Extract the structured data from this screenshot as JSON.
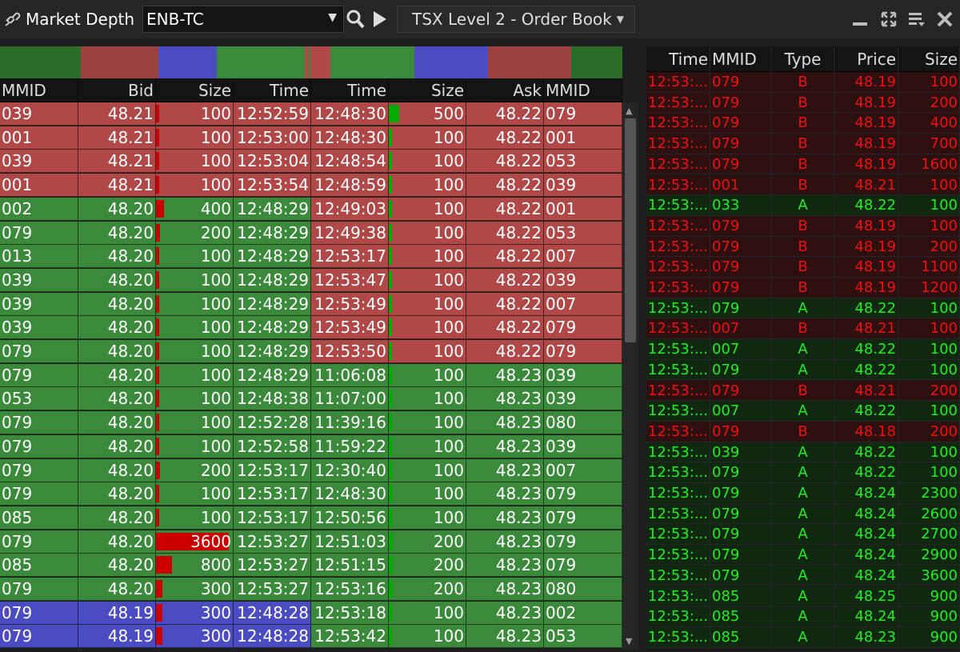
{
  "colors": {
    "bid_green": "#3b8a3b",
    "ask_red": "#b04848",
    "level_blue": "#4b4bc2",
    "bar_red": "#cc0000",
    "bar_green": "#00aa00",
    "ts_green_text": "#22ee22",
    "ts_red_text": "#ee1111",
    "ts_green_bg": "#102810",
    "ts_red_bg": "#2e1010"
  },
  "titlebar": {
    "title": "Market Depth",
    "symbol": "ENB-TC",
    "view": "TSX Level 2 - Order Book",
    "icons": [
      "link-icon",
      "search-icon",
      "play-icon",
      "minimize-icon",
      "maximize-icon",
      "menu-icon",
      "close-icon"
    ]
  },
  "depth_bar": [
    {
      "color": "#2a6e2a",
      "share": 0.13
    },
    {
      "color": "#9c4040",
      "share": 0.124
    },
    {
      "color": "#4b4bc2",
      "share": 0.094
    },
    {
      "color": "#3b8a3b",
      "share": 0.142
    },
    {
      "color": "#b04848",
      "share": 0.006
    },
    {
      "color": "#3b8a3b",
      "share": 0.003
    },
    {
      "color": "#b04848",
      "share": 0.032
    },
    {
      "color": "#3b8a3b",
      "share": 0.135
    },
    {
      "color": "#4b4bc2",
      "share": 0.118
    },
    {
      "color": "#9c4040",
      "share": 0.134
    },
    {
      "color": "#2a6e2a",
      "share": 0.082
    }
  ],
  "book": {
    "headers": [
      "MMID",
      "Bid",
      "Size",
      "Time",
      "Time",
      "Size",
      "Ask",
      "MMID"
    ],
    "max_size": 3600,
    "bids": [
      {
        "mmid": "039",
        "price": "48.21",
        "size": 100,
        "time": "12:52:59",
        "level": "red"
      },
      {
        "mmid": "001",
        "price": "48.21",
        "size": 100,
        "time": "12:53:00",
        "level": "red"
      },
      {
        "mmid": "039",
        "price": "48.21",
        "size": 100,
        "time": "12:53:04",
        "level": "red"
      },
      {
        "mmid": "001",
        "price": "48.21",
        "size": 100,
        "time": "12:53:54",
        "level": "red"
      },
      {
        "mmid": "002",
        "price": "48.20",
        "size": 400,
        "time": "12:48:29",
        "level": "green"
      },
      {
        "mmid": "079",
        "price": "48.20",
        "size": 200,
        "time": "12:48:29",
        "level": "green"
      },
      {
        "mmid": "013",
        "price": "48.20",
        "size": 100,
        "time": "12:48:29",
        "level": "green"
      },
      {
        "mmid": "039",
        "price": "48.20",
        "size": 100,
        "time": "12:48:29",
        "level": "green"
      },
      {
        "mmid": "039",
        "price": "48.20",
        "size": 100,
        "time": "12:48:29",
        "level": "green"
      },
      {
        "mmid": "039",
        "price": "48.20",
        "size": 100,
        "time": "12:48:29",
        "level": "green"
      },
      {
        "mmid": "079",
        "price": "48.20",
        "size": 100,
        "time": "12:48:29",
        "level": "green"
      },
      {
        "mmid": "079",
        "price": "48.20",
        "size": 100,
        "time": "12:48:29",
        "level": "green"
      },
      {
        "mmid": "053",
        "price": "48.20",
        "size": 100,
        "time": "12:48:38",
        "level": "green"
      },
      {
        "mmid": "079",
        "price": "48.20",
        "size": 100,
        "time": "12:52:28",
        "level": "green"
      },
      {
        "mmid": "079",
        "price": "48.20",
        "size": 100,
        "time": "12:52:58",
        "level": "green"
      },
      {
        "mmid": "079",
        "price": "48.20",
        "size": 200,
        "time": "12:53:17",
        "level": "green"
      },
      {
        "mmid": "079",
        "price": "48.20",
        "size": 100,
        "time": "12:53:17",
        "level": "green"
      },
      {
        "mmid": "085",
        "price": "48.20",
        "size": 100,
        "time": "12:53:17",
        "level": "green"
      },
      {
        "mmid": "079",
        "price": "48.20",
        "size": 3600,
        "time": "12:53:27",
        "level": "green"
      },
      {
        "mmid": "085",
        "price": "48.20",
        "size": 800,
        "time": "12:53:27",
        "level": "green"
      },
      {
        "mmid": "079",
        "price": "48.20",
        "size": 300,
        "time": "12:53:27",
        "level": "green"
      },
      {
        "mmid": "079",
        "price": "48.19",
        "size": 300,
        "time": "12:48:28",
        "level": "blue"
      },
      {
        "mmid": "079",
        "price": "48.19",
        "size": 300,
        "time": "12:48:28",
        "level": "blue"
      }
    ],
    "asks": [
      {
        "time": "12:48:30",
        "size": 500,
        "price": "48.22",
        "mmid": "079",
        "level": "red"
      },
      {
        "time": "12:48:30",
        "size": 100,
        "price": "48.22",
        "mmid": "001",
        "level": "red"
      },
      {
        "time": "12:48:54",
        "size": 100,
        "price": "48.22",
        "mmid": "053",
        "level": "red"
      },
      {
        "time": "12:48:59",
        "size": 100,
        "price": "48.22",
        "mmid": "039",
        "level": "red"
      },
      {
        "time": "12:49:03",
        "size": 100,
        "price": "48.22",
        "mmid": "001",
        "level": "red"
      },
      {
        "time": "12:49:38",
        "size": 100,
        "price": "48.22",
        "mmid": "053",
        "level": "red"
      },
      {
        "time": "12:53:17",
        "size": 100,
        "price": "48.22",
        "mmid": "007",
        "level": "red"
      },
      {
        "time": "12:53:47",
        "size": 100,
        "price": "48.22",
        "mmid": "039",
        "level": "red"
      },
      {
        "time": "12:53:49",
        "size": 100,
        "price": "48.22",
        "mmid": "007",
        "level": "red"
      },
      {
        "time": "12:53:49",
        "size": 100,
        "price": "48.22",
        "mmid": "079",
        "level": "red"
      },
      {
        "time": "12:53:50",
        "size": 100,
        "price": "48.22",
        "mmid": "079",
        "level": "red"
      },
      {
        "time": "11:06:08",
        "size": 100,
        "price": "48.23",
        "mmid": "039",
        "level": "green"
      },
      {
        "time": "11:07:00",
        "size": 100,
        "price": "48.23",
        "mmid": "039",
        "level": "green"
      },
      {
        "time": "11:39:16",
        "size": 100,
        "price": "48.23",
        "mmid": "080",
        "level": "green"
      },
      {
        "time": "11:59:22",
        "size": 100,
        "price": "48.23",
        "mmid": "039",
        "level": "green"
      },
      {
        "time": "12:30:40",
        "size": 100,
        "price": "48.23",
        "mmid": "007",
        "level": "green"
      },
      {
        "time": "12:48:30",
        "size": 100,
        "price": "48.23",
        "mmid": "079",
        "level": "green"
      },
      {
        "time": "12:50:56",
        "size": 100,
        "price": "48.23",
        "mmid": "079",
        "level": "green"
      },
      {
        "time": "12:51:03",
        "size": 200,
        "price": "48.23",
        "mmid": "079",
        "level": "green"
      },
      {
        "time": "12:51:15",
        "size": 200,
        "price": "48.23",
        "mmid": "079",
        "level": "green"
      },
      {
        "time": "12:53:16",
        "size": 200,
        "price": "48.23",
        "mmid": "080",
        "level": "green"
      },
      {
        "time": "12:53:18",
        "size": 100,
        "price": "48.23",
        "mmid": "002",
        "level": "green"
      },
      {
        "time": "12:53:42",
        "size": 100,
        "price": "48.23",
        "mmid": "053",
        "level": "green"
      }
    ]
  },
  "time_sales": {
    "headers": [
      "Time",
      "MMID",
      "Type",
      "Price",
      "Size"
    ],
    "rows": [
      {
        "time": "12:53:...",
        "mmid": "079",
        "type": "B",
        "price": "48.19",
        "size": "100"
      },
      {
        "time": "12:53:...",
        "mmid": "079",
        "type": "B",
        "price": "48.19",
        "size": "200"
      },
      {
        "time": "12:53:...",
        "mmid": "079",
        "type": "B",
        "price": "48.19",
        "size": "400"
      },
      {
        "time": "12:53:...",
        "mmid": "079",
        "type": "B",
        "price": "48.19",
        "size": "700"
      },
      {
        "time": "12:53:...",
        "mmid": "079",
        "type": "B",
        "price": "48.19",
        "size": "1600"
      },
      {
        "time": "12:53:...",
        "mmid": "001",
        "type": "B",
        "price": "48.21",
        "size": "100"
      },
      {
        "time": "12:53:...",
        "mmid": "033",
        "type": "A",
        "price": "48.22",
        "size": "100"
      },
      {
        "time": "12:53:...",
        "mmid": "079",
        "type": "B",
        "price": "48.19",
        "size": "100"
      },
      {
        "time": "12:53:...",
        "mmid": "079",
        "type": "B",
        "price": "48.19",
        "size": "200"
      },
      {
        "time": "12:53:...",
        "mmid": "079",
        "type": "B",
        "price": "48.19",
        "size": "1100"
      },
      {
        "time": "12:53:...",
        "mmid": "079",
        "type": "B",
        "price": "48.19",
        "size": "1200"
      },
      {
        "time": "12:53:...",
        "mmid": "079",
        "type": "A",
        "price": "48.22",
        "size": "100"
      },
      {
        "time": "12:53:...",
        "mmid": "007",
        "type": "B",
        "price": "48.21",
        "size": "100"
      },
      {
        "time": "12:53:...",
        "mmid": "007",
        "type": "A",
        "price": "48.22",
        "size": "100"
      },
      {
        "time": "12:53:...",
        "mmid": "079",
        "type": "A",
        "price": "48.22",
        "size": "100"
      },
      {
        "time": "12:53:...",
        "mmid": "079",
        "type": "B",
        "price": "48.21",
        "size": "200"
      },
      {
        "time": "12:53:...",
        "mmid": "007",
        "type": "A",
        "price": "48.22",
        "size": "100"
      },
      {
        "time": "12:53:...",
        "mmid": "079",
        "type": "B",
        "price": "48.18",
        "size": "200"
      },
      {
        "time": "12:53:...",
        "mmid": "039",
        "type": "A",
        "price": "48.22",
        "size": "100"
      },
      {
        "time": "12:53:...",
        "mmid": "079",
        "type": "A",
        "price": "48.22",
        "size": "100"
      },
      {
        "time": "12:53:...",
        "mmid": "079",
        "type": "A",
        "price": "48.24",
        "size": "2300"
      },
      {
        "time": "12:53:...",
        "mmid": "079",
        "type": "A",
        "price": "48.24",
        "size": "2600"
      },
      {
        "time": "12:53:...",
        "mmid": "079",
        "type": "A",
        "price": "48.24",
        "size": "2700"
      },
      {
        "time": "12:53:...",
        "mmid": "079",
        "type": "A",
        "price": "48.24",
        "size": "2900"
      },
      {
        "time": "12:53:...",
        "mmid": "079",
        "type": "A",
        "price": "48.24",
        "size": "3600"
      },
      {
        "time": "12:53:...",
        "mmid": "085",
        "type": "A",
        "price": "48.25",
        "size": "900"
      },
      {
        "time": "12:53:...",
        "mmid": "085",
        "type": "A",
        "price": "48.24",
        "size": "900"
      },
      {
        "time": "12:53:...",
        "mmid": "085",
        "type": "A",
        "price": "48.23",
        "size": "900"
      }
    ]
  }
}
